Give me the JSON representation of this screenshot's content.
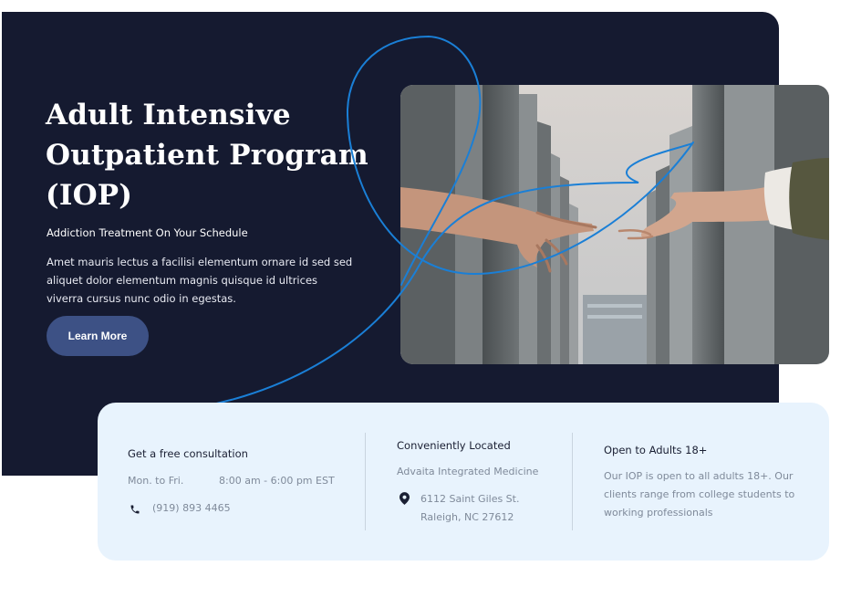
{
  "hero": {
    "title": "Adult Intensive Outpatient Program (IOP)",
    "subtitle": "Addiction Treatment On Your Schedule",
    "body": "Amet mauris lectus a facilisi elementum ornare id sed sed aliquet dolor elementum magnis quisque id ultrices viverra cursus nunc odio in egestas.",
    "cta_label": "Learn More"
  },
  "consultation": {
    "heading": "Get a free consultation",
    "days": "Mon. to Fri.",
    "hours": "8:00 am - 6:00 pm EST",
    "phone": "(919) 893 4465",
    "phone_icon": "phone-icon"
  },
  "location": {
    "heading": "Conveniently Located",
    "name": "Advaita Integrated Medicine",
    "address_line1": "6112 Saint Giles St.",
    "address_line2": "Raleigh, NC 27612",
    "pin_icon": "map-pin-icon"
  },
  "audience": {
    "heading": "Open to Adults 18+",
    "text": "Our IOP is open to all adults 18+. Our clients range from college students to working professionals"
  },
  "colors": {
    "hero_bg": "#151a30",
    "button_bg": "#3d5185",
    "card_bg": "#e8f3fd",
    "accent_line": "#1a7fd6"
  }
}
